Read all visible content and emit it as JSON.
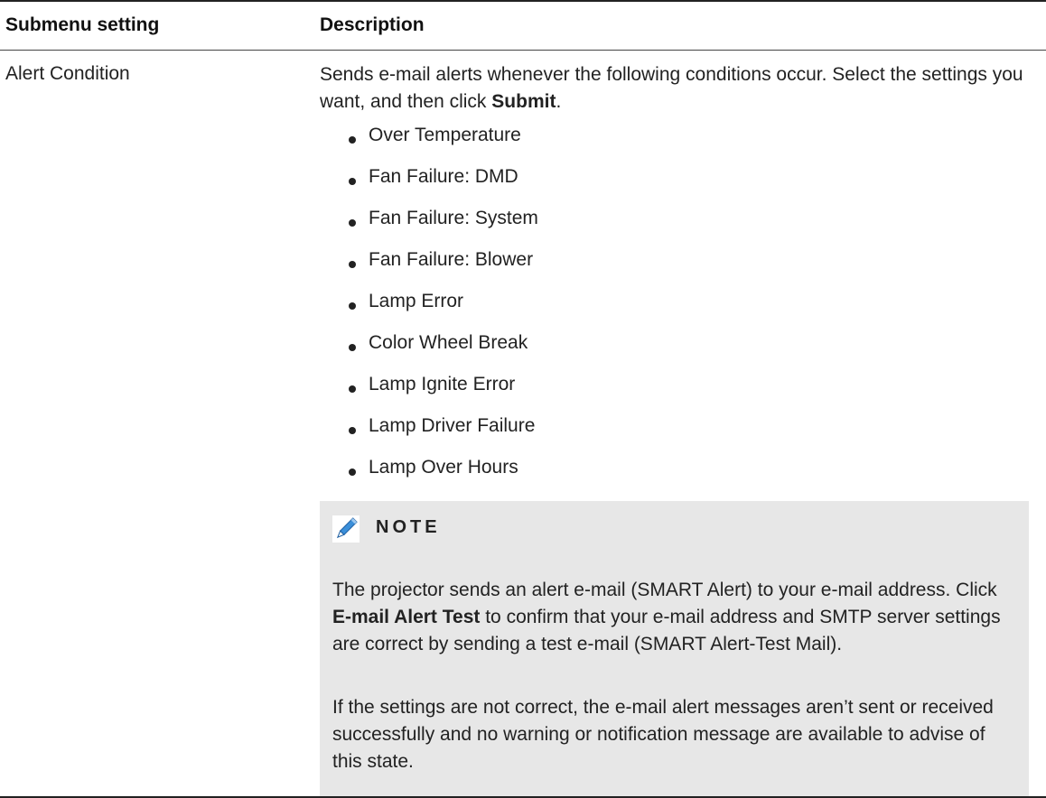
{
  "header": {
    "col1": "Submenu setting",
    "col2": "Description"
  },
  "row": {
    "setting": "Alert Condition",
    "desc_before": "Sends e-mail alerts whenever the following conditions occur. Select the settings you want, and then click ",
    "desc_bold": "Submit",
    "desc_after": ".",
    "conditions": [
      "Over Temperature",
      "Fan Failure: DMD",
      "Fan Failure: System",
      "Fan Failure: Blower",
      "Lamp Error",
      "Color Wheel Break",
      "Lamp Ignite Error",
      "Lamp Driver Failure",
      "Lamp Over Hours"
    ]
  },
  "note": {
    "icon": "pencil-icon",
    "title": "NOTE",
    "p1_before": "The projector sends an alert e-mail (SMART Alert) to your e-mail address. Click ",
    "p1_bold": "E-mail Alert Test",
    "p1_after": " to confirm that your e-mail address and SMTP server settings are correct by sending a test e-mail (SMART Alert-Test Mail).",
    "p2": "If the settings are not correct, the e-mail alert messages aren’t sent or received successfully and no warning or notification message are available to advise of this state."
  },
  "colors": {
    "note_background": "#e7e7e7",
    "icon_blue": "#3b8fd9"
  }
}
